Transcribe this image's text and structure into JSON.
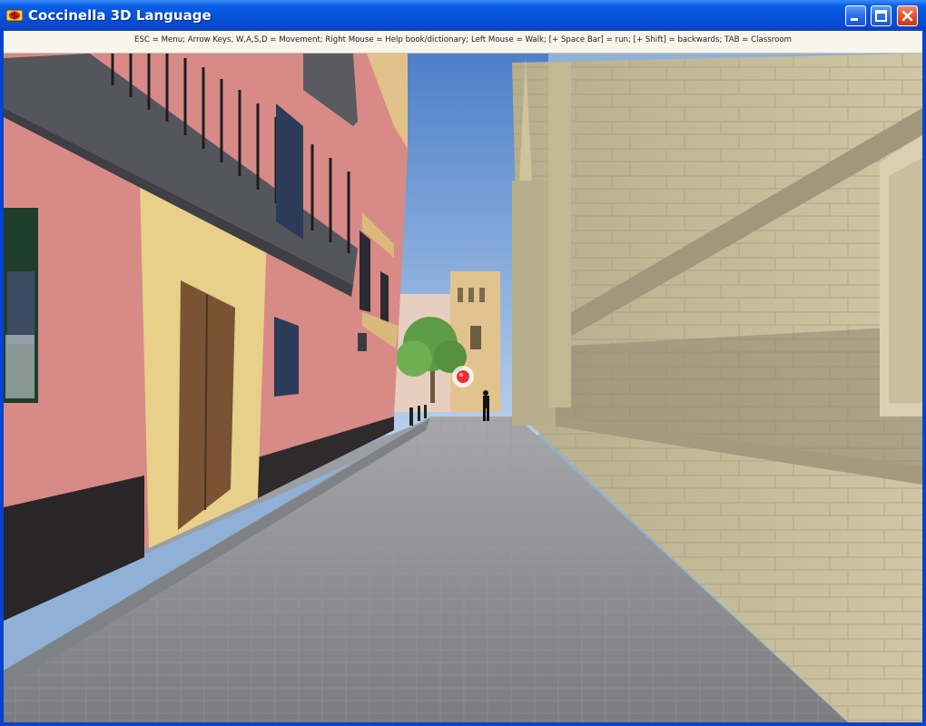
{
  "window": {
    "title": "Coccinella 3D Language",
    "controls": {
      "minimize": "minimize",
      "maximize": "maximize",
      "close": "close"
    }
  },
  "help_bar": {
    "text": "ESC = Menu;   Arrow Keys, W,A,S,D = Movement;   Right Mouse = Help book/dictionary;   Left Mouse = Walk; [+ Space Bar] = run; [+ Shift] = backwards;   TAB = Classroom"
  },
  "scene": {
    "description_icons": [
      "crosshair-icon",
      "app-ladybug-icon"
    ],
    "colors": {
      "sky": "#7fa6dc",
      "left_wall": "#d98a85",
      "left_trim": "#e8cf8a",
      "right_wall": "#c9bf9c",
      "pavement": "#8d8d8f",
      "crosshair": "#e8303a"
    }
  }
}
